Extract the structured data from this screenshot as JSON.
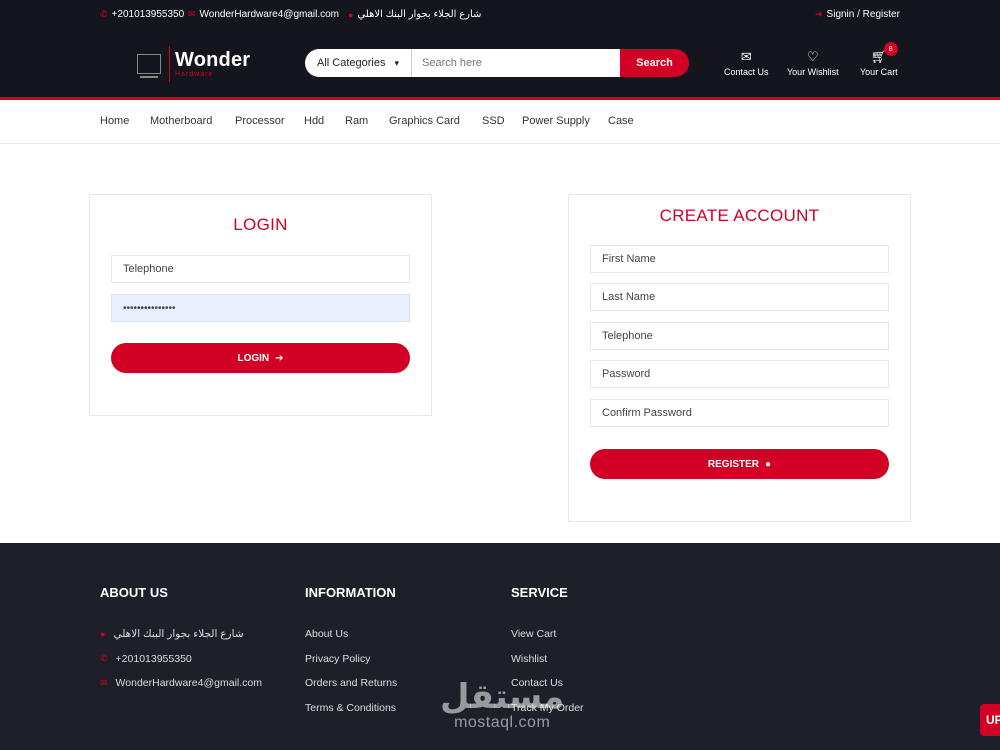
{
  "topbar": {
    "phone": "+201013955350",
    "email": "WonderHardware4@gmail.com",
    "address": "شارع الجلاء بجوار البنك الاهلي",
    "signin": "Signin / Register"
  },
  "header": {
    "logo_text": "Wonder",
    "logo_sub": "Hardware",
    "category_select": "All Categories",
    "search_placeholder": "Search here",
    "search_button": "Search",
    "contact": "Contact Us",
    "wishlist": "Your Wishlist",
    "cart": "Your Cart",
    "cart_count": "8"
  },
  "nav": {
    "items": [
      "Home",
      "Motherboard",
      "Processor",
      "Hdd",
      "Ram",
      "Graphics Card",
      "SSD",
      "Power Supply",
      "Case"
    ]
  },
  "login": {
    "title": "LOGIN",
    "telephone_placeholder": "Telephone",
    "password_value": "•••••••••••••••",
    "button": "LOGIN"
  },
  "register": {
    "title": "CREATE ACCOUNT",
    "first_name": "First Name",
    "last_name": "Last Name",
    "telephone": "Telephone",
    "password": "Password",
    "confirm_password": "Confirm Password",
    "button": "REGISTER"
  },
  "footer": {
    "about": {
      "title": "ABOUT US",
      "address": "شارع الجلاء بجوار البنك الاهلي",
      "phone": "+201013955350",
      "email": "WonderHardware4@gmail.com"
    },
    "information": {
      "title": "INFORMATION",
      "links": [
        "About Us",
        "Privacy Policy",
        "Orders and Returns",
        "Terms & Conditions"
      ]
    },
    "service": {
      "title": "SERVICE",
      "links": [
        "View Cart",
        "Wishlist",
        "Contact Us",
        "Track My Order"
      ]
    }
  },
  "watermark": {
    "arabic": "مستقل",
    "latin": "mostaql.com"
  },
  "scroll_up": "UP",
  "colors": {
    "accent": "#d10024",
    "dark": "#15161d",
    "footer": "#1e1f29"
  }
}
